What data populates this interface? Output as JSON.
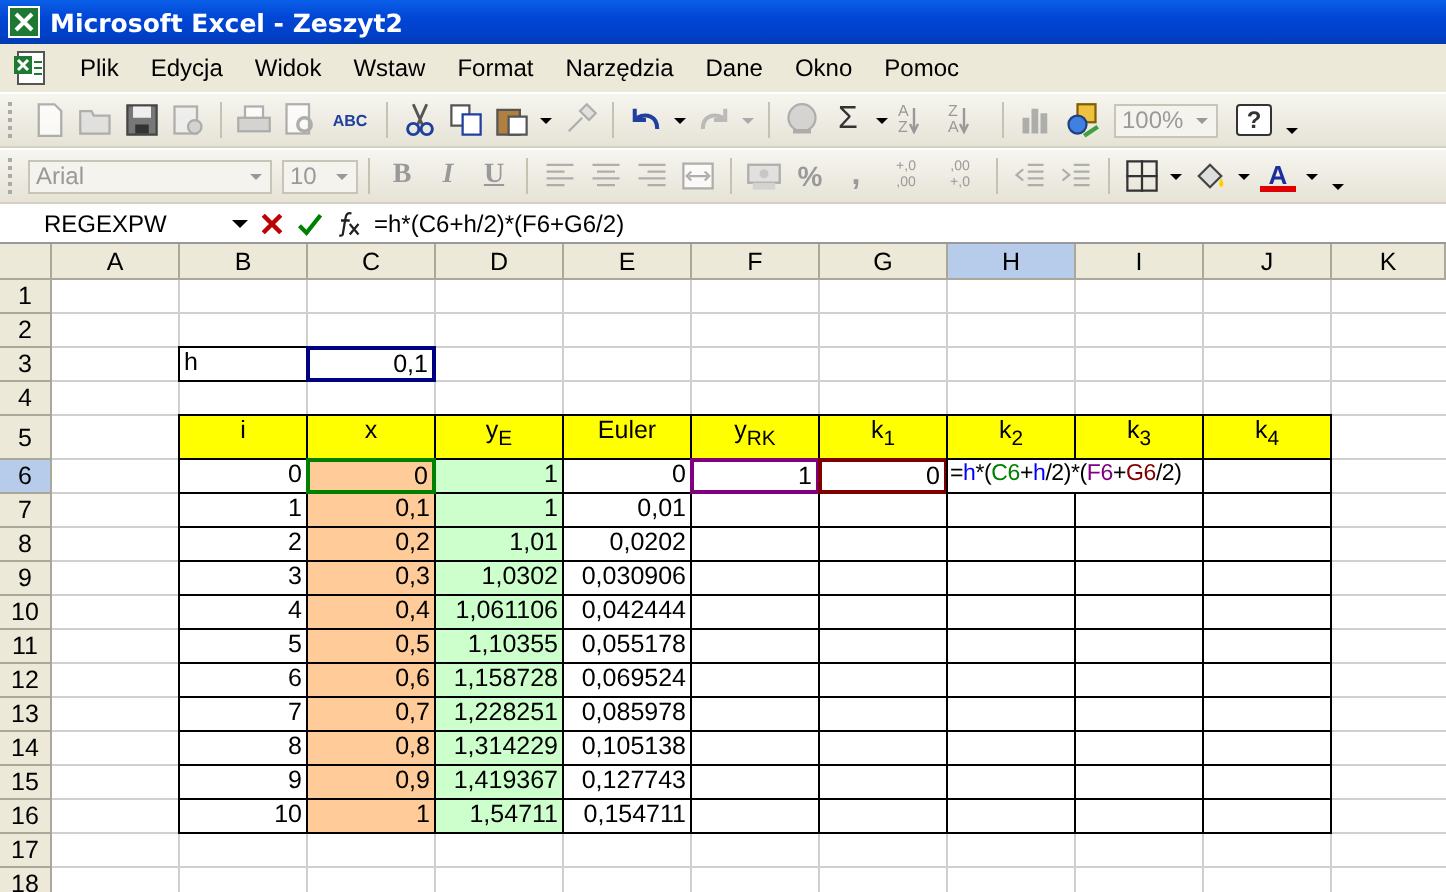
{
  "window": {
    "title": "Microsoft Excel - Zeszyt2"
  },
  "menu_bar": [
    "Plik",
    "Edycja",
    "Widok",
    "Wstaw",
    "Format",
    "Narzędzia",
    "Dane",
    "Okno",
    "Pomoc"
  ],
  "standard_toolbar": {
    "spelling": "ABC",
    "autosum": "Σ",
    "sort_ascending": [
      "A",
      "Z"
    ],
    "sort_descending": [
      "Z",
      "A"
    ],
    "zoom": {
      "value": "100%",
      "disabled": true
    },
    "help": "?"
  },
  "formatting_toolbar": {
    "font": {
      "value": "Arial",
      "disabled": true
    },
    "size": {
      "value": "10",
      "disabled": true
    },
    "bold": "B",
    "italic": "I",
    "underline": "U",
    "percent": "%",
    "comma": ",",
    "increase_decimal": [
      "+,0",
      ",00"
    ],
    "decrease_decimal": [
      ",00",
      "+,0"
    ],
    "font_color": "A"
  },
  "formula_bar": {
    "name_box": "REGEXPW",
    "formula": "=h*(C6+h/2)*(F6+G6/2)"
  },
  "sheet": {
    "columns": [
      {
        "label": "A",
        "selected": false
      },
      {
        "label": "B",
        "selected": false
      },
      {
        "label": "C",
        "selected": false
      },
      {
        "label": "D",
        "selected": false
      },
      {
        "label": "E",
        "selected": false
      },
      {
        "label": "F",
        "selected": false
      },
      {
        "label": "G",
        "selected": false
      },
      {
        "label": "H",
        "selected": true
      },
      {
        "label": "I",
        "selected": false
      },
      {
        "label": "J",
        "selected": false
      },
      {
        "label": "K",
        "selected": false
      }
    ],
    "rows": [
      {
        "label": "1",
        "selected": false,
        "cells": []
      },
      {
        "label": "2",
        "selected": false,
        "cells": []
      },
      {
        "label": "3",
        "selected": false,
        "cells": [
          {
            "kind": "blank"
          },
          {
            "kind": "label",
            "text": "h"
          },
          {
            "kind": "plain",
            "text": "0,1",
            "color": "#000080"
          }
        ]
      },
      {
        "label": "4",
        "selected": false,
        "cells": []
      },
      {
        "label": "5",
        "selected": false,
        "cells": [
          {
            "kind": "blank"
          },
          {
            "kind": "header",
            "text": "i"
          },
          {
            "kind": "header",
            "text": "x"
          },
          {
            "kind": "header",
            "text": "y$_{E}$"
          },
          {
            "kind": "header",
            "text": "Euler"
          },
          {
            "kind": "header",
            "text": "y$_{RK}$"
          },
          {
            "kind": "header",
            "text": "k$_{1}$"
          },
          {
            "kind": "header",
            "text": "k$_{2}$"
          },
          {
            "kind": "header",
            "text": "k$_{3}$"
          },
          {
            "kind": "header",
            "text": "k$_{4}$"
          }
        ]
      },
      {
        "label": "6",
        "selected": true,
        "cells": [
          {
            "kind": "blank"
          },
          {
            "kind": "plain",
            "text": "0"
          },
          {
            "kind": "x",
            "text": "0",
            "color": "#008000"
          },
          {
            "kind": "y",
            "text": "1"
          },
          {
            "kind": "plain",
            "text": "0"
          },
          {
            "kind": "plain",
            "text": "1",
            "color": "#800080"
          },
          {
            "kind": "plain",
            "text": "0",
            "color": "#800000"
          },
          {
            "kind": "editing",
            "segments": [
              {
                "text": "=",
                "color": "#000000"
              },
              {
                "text": "h",
                "color": "#0000ff"
              },
              {
                "text": "*(",
                "color": "#000000"
              },
              {
                "text": "C6",
                "color": "#008000"
              },
              {
                "text": "+",
                "color": "#000000"
              },
              {
                "text": "h",
                "color": "#0000ff"
              },
              {
                "text": "/2)*(",
                "color": "#000000"
              },
              {
                "text": "F6",
                "color": "#800080"
              },
              {
                "text": "+",
                "color": "#000000"
              },
              {
                "text": "G6",
                "color": "#800000"
              },
              {
                "text": "/2)",
                "color": "#000000"
              }
            ]
          },
          {
            "kind": "plain"
          }
        ]
      },
      {
        "label": "7",
        "selected": false,
        "cells": [
          {
            "kind": "blank"
          },
          {
            "kind": "plain",
            "text": "1"
          },
          {
            "kind": "x",
            "text": "0,1"
          },
          {
            "kind": "y",
            "text": "1"
          },
          {
            "kind": "plain",
            "text": "0,01"
          },
          {
            "kind": "plain"
          },
          {
            "kind": "plain"
          },
          {
            "kind": "plain"
          },
          {
            "kind": "plain"
          },
          {
            "kind": "plain"
          }
        ]
      },
      {
        "label": "8",
        "selected": false,
        "cells": [
          {
            "kind": "blank"
          },
          {
            "kind": "plain",
            "text": "2"
          },
          {
            "kind": "x",
            "text": "0,2"
          },
          {
            "kind": "y",
            "text": "1,01"
          },
          {
            "kind": "plain",
            "text": "0,0202"
          },
          {
            "kind": "plain"
          },
          {
            "kind": "plain"
          },
          {
            "kind": "plain"
          },
          {
            "kind": "plain"
          },
          {
            "kind": "plain"
          }
        ]
      },
      {
        "label": "9",
        "selected": false,
        "cells": [
          {
            "kind": "blank"
          },
          {
            "kind": "plain",
            "text": "3"
          },
          {
            "kind": "x",
            "text": "0,3"
          },
          {
            "kind": "y",
            "text": "1,0302"
          },
          {
            "kind": "plain",
            "text": "0,030906"
          },
          {
            "kind": "plain"
          },
          {
            "kind": "plain"
          },
          {
            "kind": "plain"
          },
          {
            "kind": "plain"
          },
          {
            "kind": "plain"
          }
        ]
      },
      {
        "label": "10",
        "selected": false,
        "cells": [
          {
            "kind": "blank"
          },
          {
            "kind": "plain",
            "text": "4"
          },
          {
            "kind": "x",
            "text": "0,4"
          },
          {
            "kind": "y",
            "text": "1,061106"
          },
          {
            "kind": "plain",
            "text": "0,042444"
          },
          {
            "kind": "plain"
          },
          {
            "kind": "plain"
          },
          {
            "kind": "plain"
          },
          {
            "kind": "plain"
          },
          {
            "kind": "plain"
          }
        ]
      },
      {
        "label": "11",
        "selected": false,
        "cells": [
          {
            "kind": "blank"
          },
          {
            "kind": "plain",
            "text": "5"
          },
          {
            "kind": "x",
            "text": "0,5"
          },
          {
            "kind": "y",
            "text": "1,10355"
          },
          {
            "kind": "plain",
            "text": "0,055178"
          },
          {
            "kind": "plain"
          },
          {
            "kind": "plain"
          },
          {
            "kind": "plain"
          },
          {
            "kind": "plain"
          },
          {
            "kind": "plain"
          }
        ]
      },
      {
        "label": "12",
        "selected": false,
        "cells": [
          {
            "kind": "blank"
          },
          {
            "kind": "plain",
            "text": "6"
          },
          {
            "kind": "x",
            "text": "0,6"
          },
          {
            "kind": "y",
            "text": "1,158728"
          },
          {
            "kind": "plain",
            "text": "0,069524"
          },
          {
            "kind": "plain"
          },
          {
            "kind": "plain"
          },
          {
            "kind": "plain"
          },
          {
            "kind": "plain"
          },
          {
            "kind": "plain"
          }
        ]
      },
      {
        "label": "13",
        "selected": false,
        "cells": [
          {
            "kind": "blank"
          },
          {
            "kind": "plain",
            "text": "7"
          },
          {
            "kind": "x",
            "text": "0,7"
          },
          {
            "kind": "y",
            "text": "1,228251"
          },
          {
            "kind": "plain",
            "text": "0,085978"
          },
          {
            "kind": "plain"
          },
          {
            "kind": "plain"
          },
          {
            "kind": "plain"
          },
          {
            "kind": "plain"
          },
          {
            "kind": "plain"
          }
        ]
      },
      {
        "label": "14",
        "selected": false,
        "cells": [
          {
            "kind": "blank"
          },
          {
            "kind": "plain",
            "text": "8"
          },
          {
            "kind": "x",
            "text": "0,8"
          },
          {
            "kind": "y",
            "text": "1,314229"
          },
          {
            "kind": "plain",
            "text": "0,105138"
          },
          {
            "kind": "plain"
          },
          {
            "kind": "plain"
          },
          {
            "kind": "plain"
          },
          {
            "kind": "plain"
          },
          {
            "kind": "plain"
          }
        ]
      },
      {
        "label": "15",
        "selected": false,
        "cells": [
          {
            "kind": "blank"
          },
          {
            "kind": "plain",
            "text": "9"
          },
          {
            "kind": "x",
            "text": "0,9"
          },
          {
            "kind": "y",
            "text": "1,419367"
          },
          {
            "kind": "plain",
            "text": "0,127743"
          },
          {
            "kind": "plain"
          },
          {
            "kind": "plain"
          },
          {
            "kind": "plain"
          },
          {
            "kind": "plain"
          },
          {
            "kind": "plain"
          }
        ]
      },
      {
        "label": "16",
        "selected": false,
        "cells": [
          {
            "kind": "blank"
          },
          {
            "kind": "plain",
            "text": "10"
          },
          {
            "kind": "x",
            "text": "1"
          },
          {
            "kind": "y",
            "text": "1,54711"
          },
          {
            "kind": "plain",
            "text": "0,154711"
          },
          {
            "kind": "plain"
          },
          {
            "kind": "plain"
          },
          {
            "kind": "plain"
          },
          {
            "kind": "plain"
          },
          {
            "kind": "plain"
          }
        ]
      },
      {
        "label": "17",
        "selected": false,
        "cells": []
      },
      {
        "label": "18",
        "selected": false,
        "cells": []
      }
    ]
  }
}
